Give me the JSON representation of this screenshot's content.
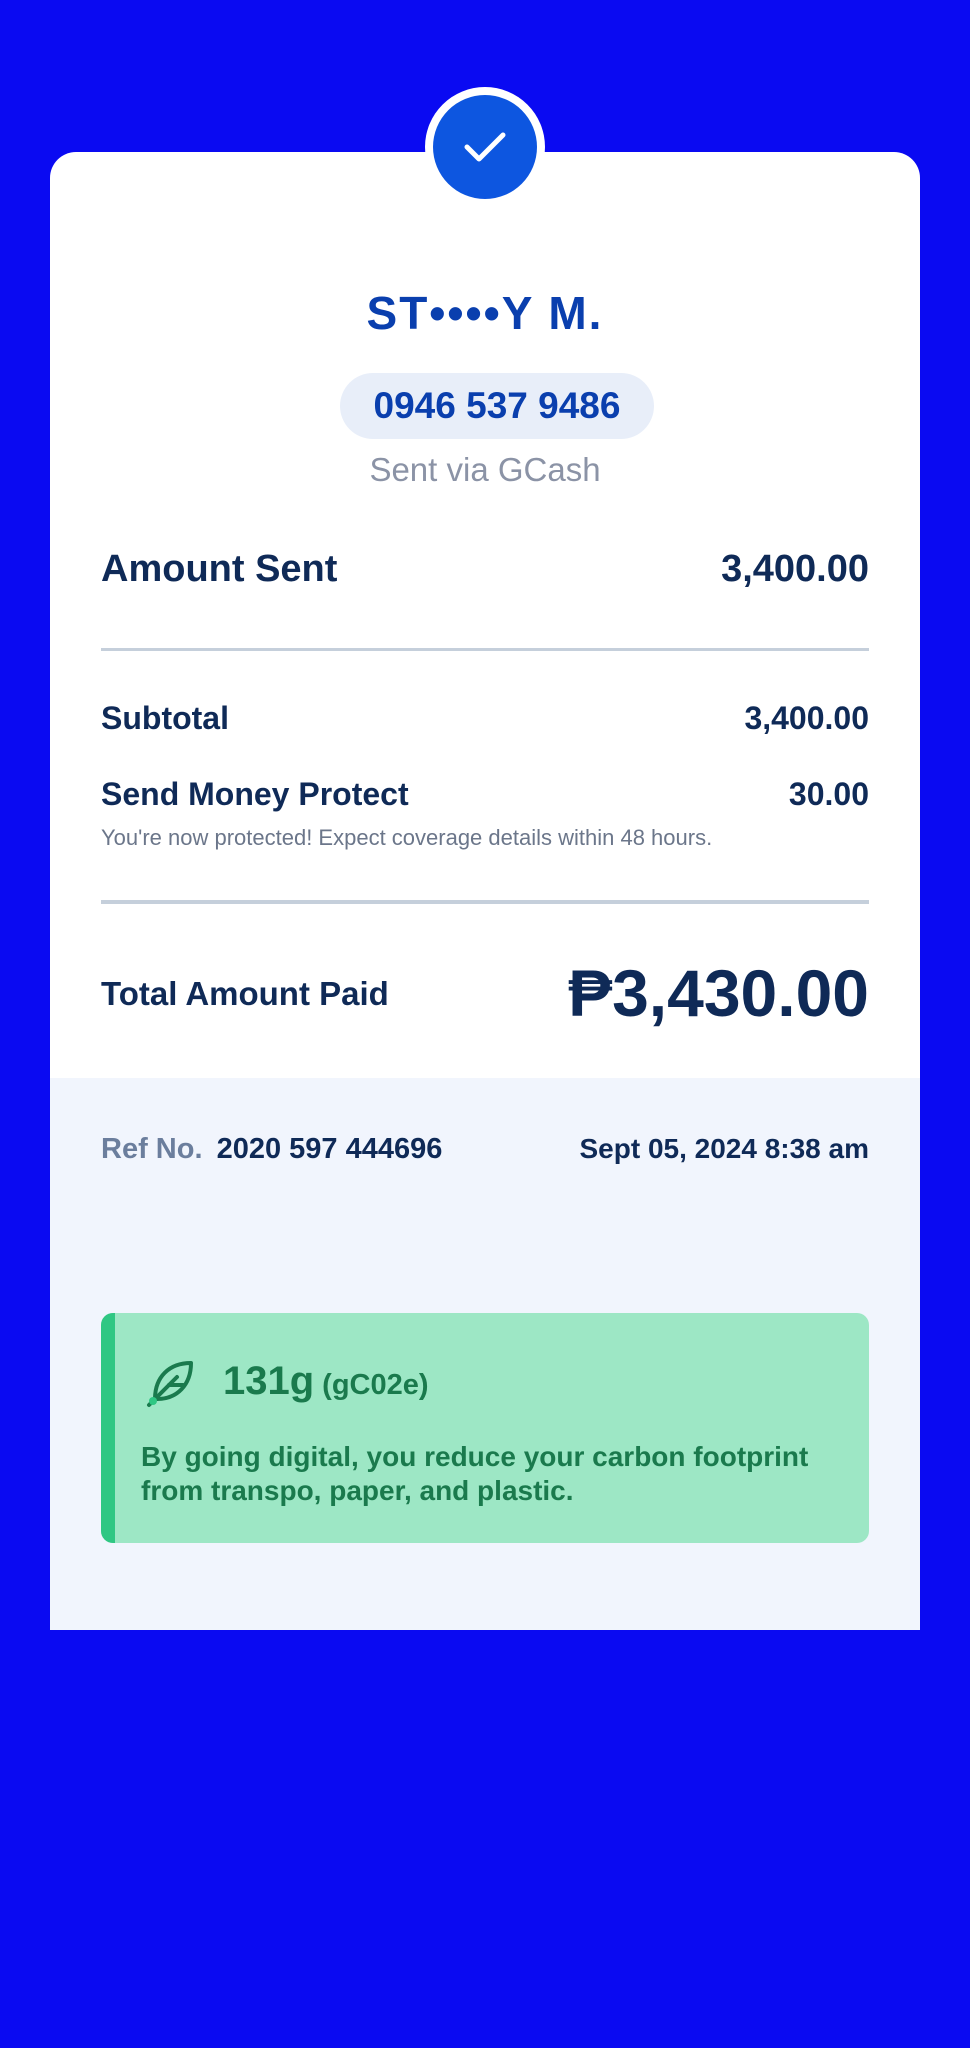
{
  "recipient": {
    "name": "ST••••Y M.",
    "phone": "0946 537 9486",
    "channel": "Sent via GCash"
  },
  "amounts": {
    "amount_sent_label": "Amount Sent",
    "amount_sent_value": "3,400.00",
    "subtotal_label": "Subtotal",
    "subtotal_value": "3,400.00",
    "protect_label": "Send Money Protect",
    "protect_value": "30.00",
    "protect_note": "You're now protected! Expect coverage details within 48 hours.",
    "total_label": "Total Amount Paid",
    "total_value": "₱3,430.00"
  },
  "reference": {
    "label": "Ref No.",
    "number": "2020 597 444696",
    "datetime": "Sept 05, 2024 8:38 am"
  },
  "eco": {
    "amount": "131g",
    "unit": "(gC02e)",
    "message": "By going digital, you reduce your carbon footprint from transpo, paper, and plastic."
  },
  "icons": {
    "status": "checkmark-icon",
    "eco": "leaf-icon"
  },
  "colors": {
    "background": "#0a0af2",
    "brand_blue": "#0d56e0",
    "text_dark": "#0f2a57",
    "eco_green_bg": "#9de7c5",
    "eco_green_text": "#1a7a4d"
  }
}
